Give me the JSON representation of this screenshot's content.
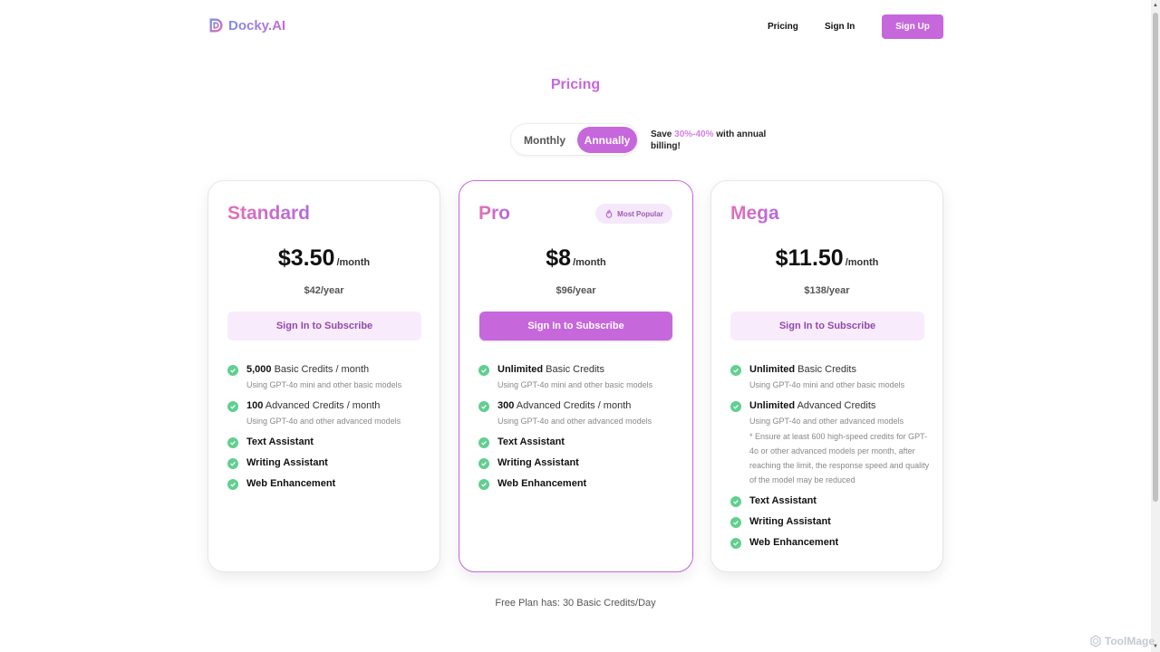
{
  "brand": {
    "name": "Docky.AI"
  },
  "nav": {
    "pricing": "Pricing",
    "sign_in": "Sign In",
    "sign_up": "Sign Up"
  },
  "title": "Pricing",
  "toggle": {
    "monthly": "Monthly",
    "annually": "Annually",
    "selected": "Annually"
  },
  "save_note": {
    "prefix": "Save ",
    "highlight": "30%-40%",
    "suffix": " with annual billing!"
  },
  "plans": [
    {
      "name": "Standard",
      "price": "$3.50",
      "unit": "/month",
      "yearly": "$42/year",
      "cta": "Sign In to Subscribe",
      "features": [
        {
          "strong": "5,000",
          "text": " Basic Credits / month",
          "sub": "Using GPT-4o mini and other basic models"
        },
        {
          "strong": "100",
          "text": " Advanced Credits / month",
          "sub": "Using GPT-4o and other advanced models"
        },
        {
          "title": "Text Assistant"
        },
        {
          "title": "Writing Assistant"
        },
        {
          "title": "Web Enhancement"
        }
      ]
    },
    {
      "name": "Pro",
      "badge": "Most Popular",
      "price": "$8",
      "unit": "/month",
      "yearly": "$96/year",
      "cta": "Sign In to Subscribe",
      "features": [
        {
          "strong": "Unlimited",
          "text": " Basic Credits",
          "sub": "Using GPT-4o mini and other basic models"
        },
        {
          "strong": "300",
          "text": " Advanced Credits / month",
          "sub": "Using GPT-4o and other advanced models"
        },
        {
          "title": "Text Assistant"
        },
        {
          "title": "Writing Assistant"
        },
        {
          "title": "Web Enhancement"
        }
      ]
    },
    {
      "name": "Mega",
      "price": "$11.50",
      "unit": "/month",
      "yearly": "$138/year",
      "cta": "Sign In to Subscribe",
      "features": [
        {
          "strong": "Unlimited",
          "text": " Basic Credits",
          "sub": "Using GPT-4o mini and other basic models"
        },
        {
          "strong": "Unlimited",
          "text": " Advanced Credits",
          "sub": "Using GPT-4o and other advanced models",
          "note": "* Ensure at least 600 high-speed credits for GPT-4o or other advanced models per month, after reaching the limit, the response speed and quality of the model may be reduced"
        },
        {
          "title": "Text Assistant"
        },
        {
          "title": "Writing Assistant"
        },
        {
          "title": "Web Enhancement"
        }
      ]
    }
  ],
  "footer": "Free Plan has: 30 Basic Credits/Day",
  "watermark": "ToolMage",
  "icons": {
    "check": "check-circle-icon",
    "fire": "flame-icon",
    "logo": "docky-logo-icon"
  },
  "colors": {
    "accent": "#c667dc",
    "check": "#61cf8f"
  }
}
